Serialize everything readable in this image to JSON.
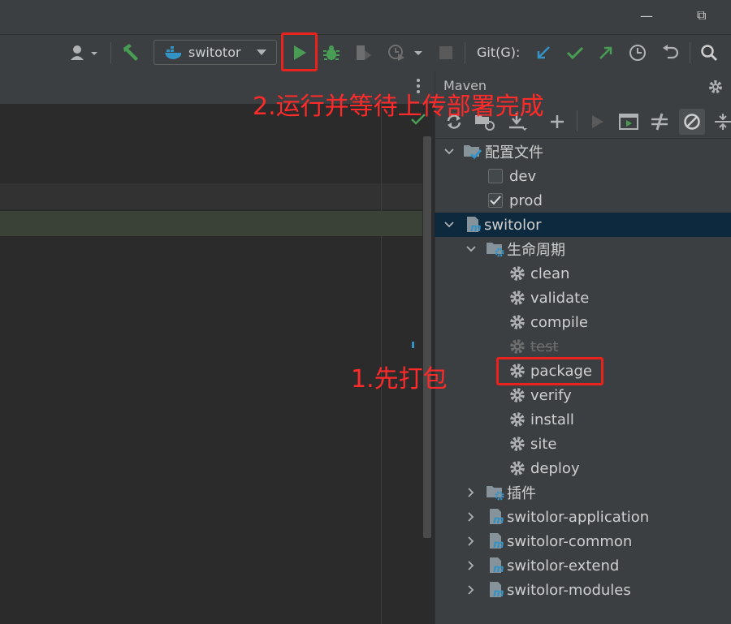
{
  "window": {
    "minimize_symbol": "—",
    "restore_symbol": "⧉"
  },
  "toolbar": {
    "run_config": "switotor",
    "git_label": "Git(G):"
  },
  "maven": {
    "title": "Maven",
    "profiles_label": "配置文件",
    "profiles": [
      {
        "label": "dev",
        "checked": false
      },
      {
        "label": "prod",
        "checked": true
      }
    ],
    "project": "switolor",
    "lifecycle_label": "生命周期",
    "lifecycle": [
      {
        "label": "clean",
        "disabled": false
      },
      {
        "label": "validate",
        "disabled": false
      },
      {
        "label": "compile",
        "disabled": false
      },
      {
        "label": "test",
        "disabled": true
      },
      {
        "label": "package",
        "disabled": false
      },
      {
        "label": "verify",
        "disabled": false
      },
      {
        "label": "install",
        "disabled": false
      },
      {
        "label": "site",
        "disabled": false
      },
      {
        "label": "deploy",
        "disabled": false
      }
    ],
    "plugins_label": "插件",
    "modules": [
      "switolor-application",
      "switolor-common",
      "switolor-extend",
      "switolor-modules"
    ]
  },
  "annotations": {
    "step1": "1.先打包",
    "step2": "2.运行并等待上传部署完成"
  },
  "colors": {
    "accent_red": "#e8231e",
    "run_green": "#499c54",
    "git_blue": "#3592c4"
  }
}
